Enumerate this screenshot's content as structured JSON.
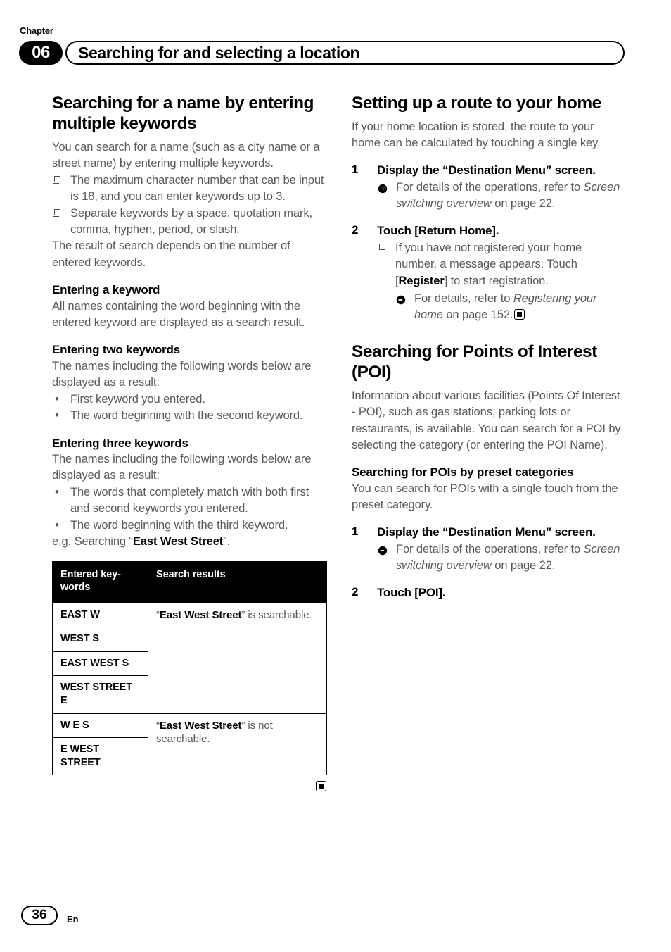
{
  "header": {
    "chapter_label": "Chapter",
    "chapter_number": "06",
    "title": "Searching for and selecting a location"
  },
  "footer": {
    "page_number": "36",
    "language": "En"
  },
  "left_column": {
    "section_title": "Searching for a name by entering multiple keywords",
    "intro": "You can search for a name (such as a city name or a street name) by entering multiple keywords.",
    "notes": [
      "The maximum character number that can be input is 18, and you can enter keywords up to 3.",
      "Separate keywords by a space, quotation mark, comma, hyphen, period, or slash."
    ],
    "result_note": "The result of search depends on the number of entered keywords.",
    "sub1": {
      "heading": "Entering a keyword",
      "body": "All names containing the word beginning with the entered keyword are displayed as a search result."
    },
    "sub2": {
      "heading": "Entering two keywords",
      "body": "The names including the following words below are displayed as a result:",
      "bullets": [
        "First keyword you entered.",
        "The word beginning with the second keyword."
      ]
    },
    "sub3": {
      "heading": "Entering three keywords",
      "body": "The names including the following words below are displayed as a result:",
      "bullets": [
        "The words that completely match with both first and second keywords you entered.",
        "The word beginning with the third keyword."
      ],
      "example_prefix": "e.g. Searching “",
      "example_bold": "East West Street",
      "example_suffix": "”."
    },
    "table": {
      "headers": [
        "Entered key-words",
        "Search results"
      ],
      "groups": [
        {
          "keywords": [
            "EAST W",
            "WEST S",
            "EAST WEST S",
            "WEST STREET E"
          ],
          "result_open_quote": "“",
          "result_bold": "East West Street",
          "result_close_quote": "”",
          "result_text": " is searchable."
        },
        {
          "keywords": [
            "W E S",
            "E WEST STREET"
          ],
          "result_open_quote": "“",
          "result_bold": "East West Street",
          "result_close_quote": "”",
          "result_text": " is not searchable."
        }
      ]
    }
  },
  "right_column": {
    "home": {
      "section_title": "Setting up a route to your home",
      "intro": "If your home location is stored, the route to your home can be calculated by touching a single key.",
      "step1": {
        "number": "1",
        "title": "Display the “Destination Menu” screen.",
        "xref_prefix": "For details of the operations, refer to ",
        "xref_italic": "Screen switching overview",
        "xref_suffix": " on page 22."
      },
      "step2": {
        "number": "2",
        "title": "Touch [Return Home].",
        "note_prefix": "If you have not registered your home number, a message appears. Touch [",
        "note_bold": "Register",
        "note_suffix": "] to start registration.",
        "xref_prefix": "For details, refer to ",
        "xref_italic": "Registering your home",
        "xref_suffix": " on page 152."
      }
    },
    "poi": {
      "section_title": "Searching for Points of Interest (POI)",
      "intro": "Information about various facilities (Points Of Interest - POI), such as gas stations, parking lots or restaurants, is available. You can search for a POI by selecting the category (or entering the POI Name).",
      "sub_heading": "Searching for POIs by preset categories",
      "sub_body": "You can search for POIs with a single touch from the preset category.",
      "step1": {
        "number": "1",
        "title": "Display the “Destination Menu” screen.",
        "xref_prefix": "For details of the operations, refer to ",
        "xref_italic": "Screen switching overview",
        "xref_suffix": " on page 22."
      },
      "step2": {
        "number": "2",
        "title": "Touch [POI]."
      }
    }
  },
  "icons": {
    "note_square": "note-square-icon",
    "xref_arrow": "arrow-circle-right-icon",
    "end_marker": "end-of-section-marker-icon"
  }
}
